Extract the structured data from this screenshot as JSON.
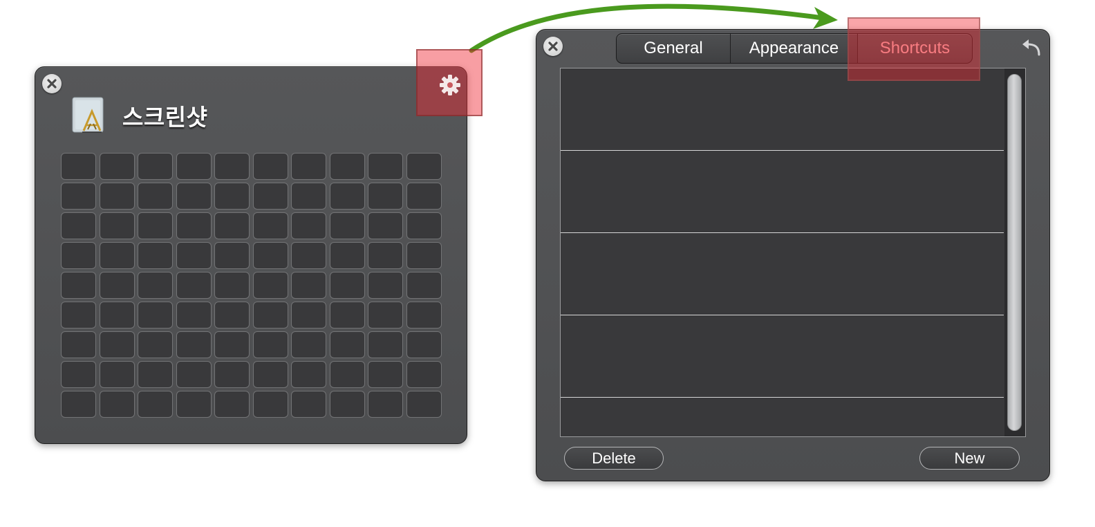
{
  "launcher": {
    "title": "스크린샷",
    "app_icon": "preview-app-icon",
    "close_icon": "close-icon",
    "settings_icon": "gear-icon",
    "grid": {
      "rows": 9,
      "columns": 10
    }
  },
  "preferences": {
    "close_icon": "close-icon",
    "undo_icon": "undo-arrow-icon",
    "tabs": [
      {
        "label": "General",
        "selected": false
      },
      {
        "label": "Appearance",
        "selected": false
      },
      {
        "label": "Shortcuts",
        "selected": true
      }
    ],
    "shortcut_rows": 5,
    "buttons": {
      "delete": "Delete",
      "new": "New"
    }
  },
  "annotations": {
    "highlight_color": "#f02832",
    "arrow_color": "#4a9a1e"
  }
}
